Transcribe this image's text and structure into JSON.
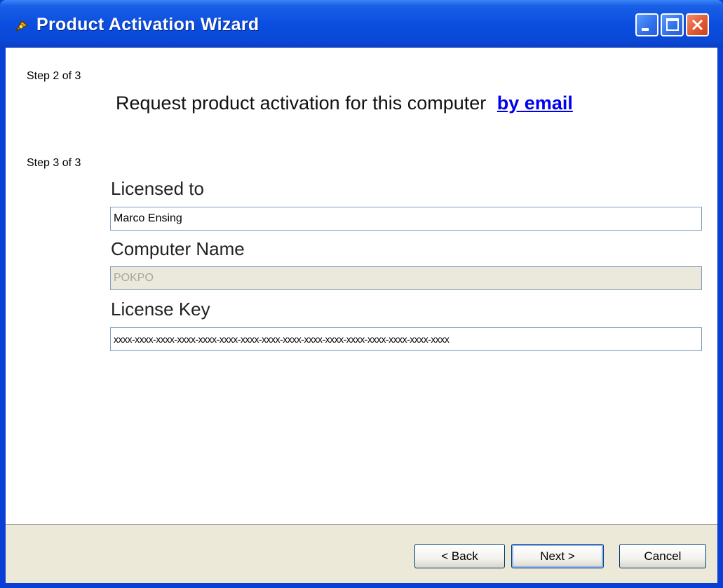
{
  "window": {
    "title": "Product Activation Wizard",
    "controls": [
      "minimize",
      "maximize",
      "close"
    ]
  },
  "step2": {
    "label": "Step 2 of 3",
    "request_text": "Request product activation for this computer",
    "link_text": "by email"
  },
  "step3": {
    "label": "Step 3 of 3",
    "licensed_to_label": "Licensed to",
    "licensed_to_value": "Marco Ensing",
    "computer_name_label": "Computer Name",
    "computer_name_value": "POKPO",
    "license_key_label": "License Key",
    "license_key_value": "xxxx-xxxx-xxxx-xxxx-xxxx-xxxx-xxxx-xxxx-xxxx-xxxx-xxxx-xxxx-xxxx-xxxx-xxxx-xxxx"
  },
  "buttons": {
    "back": "< Back",
    "next": "Next >",
    "cancel": "Cancel"
  },
  "colors": {
    "titlebar": "#0a4ee0",
    "link": "#0000ee",
    "footer": "#ece9d8"
  }
}
